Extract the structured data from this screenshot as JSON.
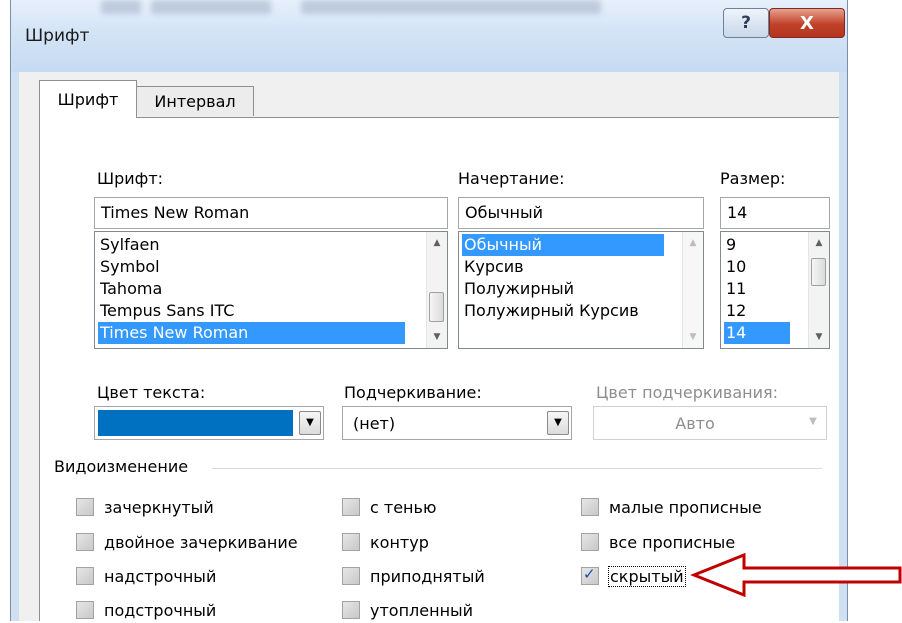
{
  "window": {
    "title": "Шрифт",
    "help_glyph": "?",
    "close_glyph": "X"
  },
  "tabs": [
    {
      "label": "Шрифт",
      "underline": "р"
    },
    {
      "label": "Интервал",
      "underline": "л"
    }
  ],
  "font": {
    "label": "Шрифт:",
    "value": "Times New Roman",
    "items": [
      "Sylfaen",
      "Symbol",
      "Tahoma",
      "Tempus Sans ITC",
      "Times New Roman"
    ],
    "selected": "Times New Roman"
  },
  "style": {
    "label": "Начертание:",
    "value": "Обычный",
    "items": [
      "Обычный",
      "Курсив",
      "Полужирный",
      "Полужирный Курсив"
    ],
    "selected": "Обычный"
  },
  "size": {
    "label": "Размер:",
    "value": "14",
    "items": [
      "9",
      "10",
      "11",
      "12",
      "14"
    ],
    "selected": "14"
  },
  "text_color": {
    "label": "Цвет текста:",
    "color": "#0070c0"
  },
  "underline": {
    "label": "Подчеркивание:",
    "value": "(нет)"
  },
  "underline_color": {
    "label": "Цвет подчеркивания:",
    "value": "Авто",
    "disabled": true
  },
  "effects": {
    "title": "Видоизменение",
    "items": [
      {
        "label": "зачеркнутый",
        "checked": false
      },
      {
        "label": "двойное зачеркивание",
        "checked": false
      },
      {
        "label": "надстрочный",
        "checked": false
      },
      {
        "label": "подстрочный",
        "checked": false
      },
      {
        "label": "с тенью",
        "checked": false
      },
      {
        "label": "контур",
        "checked": false
      },
      {
        "label": "приподнятый",
        "checked": false
      },
      {
        "label": "утопленный",
        "checked": false
      },
      {
        "label": "малые прописные",
        "checked": false
      },
      {
        "label": "все прописные",
        "checked": false
      },
      {
        "label": "скрытый",
        "checked": true
      }
    ]
  },
  "annotation": {
    "arrow_color": "#c00000"
  }
}
